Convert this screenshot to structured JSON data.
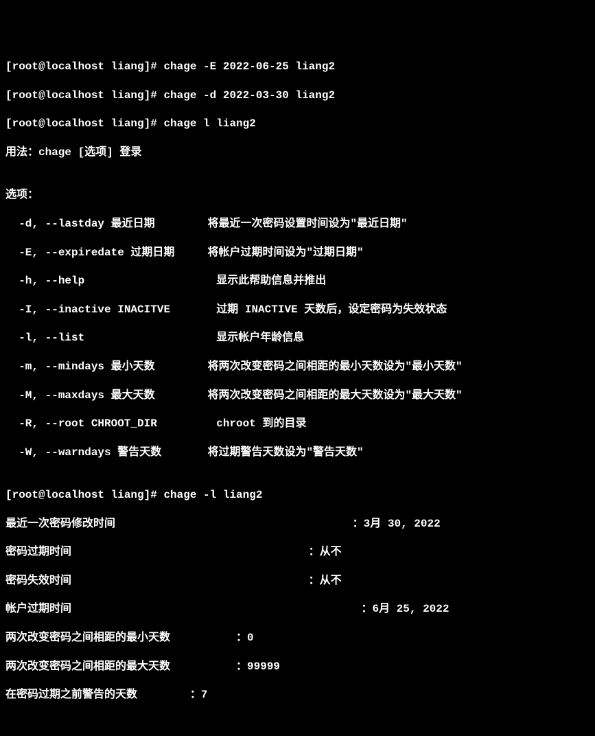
{
  "lines": {
    "prompt1": "[root@localhost liang]# chage -E 2022-06-25 liang2",
    "prompt2": "[root@localhost liang]# chage -d 2022-03-30 liang2",
    "prompt3": "[root@localhost liang]# chage l liang2",
    "usage": "用法：chage [选项] 登录",
    "blank1": "",
    "options_header": "选项：",
    "opt_d": "  -d, --lastday 最近日期        将最近一次密码设置时间设为\"最近日期\"",
    "opt_E": "  -E, --expiredate 过期日期     将帐户过期时间设为\"过期日期\"",
    "opt_h": "  -h, --help                    显示此帮助信息并推出",
    "opt_I": "  -I, --inactive INACITVE       过期 INACTIVE 天数后，设定密码为失效状态",
    "opt_l": "  -l, --list                    显示帐户年龄信息",
    "opt_m": "  -m, --mindays 最小天数        将两次改变密码之间相距的最小天数设为\"最小天数\"",
    "opt_M": "  -M, --maxdays 最大天数        将两次改变密码之间相距的最大天数设为\"最大天数\"",
    "opt_R": "  -R, --root CHROOT_DIR         chroot 到的目录",
    "opt_W": "  -W, --warndays 警告天数       将过期警告天数设为\"警告天数\"",
    "blank2": "",
    "prompt4": "[root@localhost liang]# chage -l liang2",
    "info_lastchange": "最近一次密码修改时间                                    ：3月 30, 2022",
    "info_pwexpire": "密码过期时间                                    ：从不",
    "info_pwinactive": "密码失效时间                                    ：从不",
    "info_acctexpire": "帐户过期时间                                            ：6月 25, 2022",
    "info_mindays": "两次改变密码之间相距的最小天数          ：0",
    "info_maxdays": "两次改变密码之间相距的最大天数          ：99999",
    "info_warndays": "在密码过期之前警告的天数        ：7"
  }
}
